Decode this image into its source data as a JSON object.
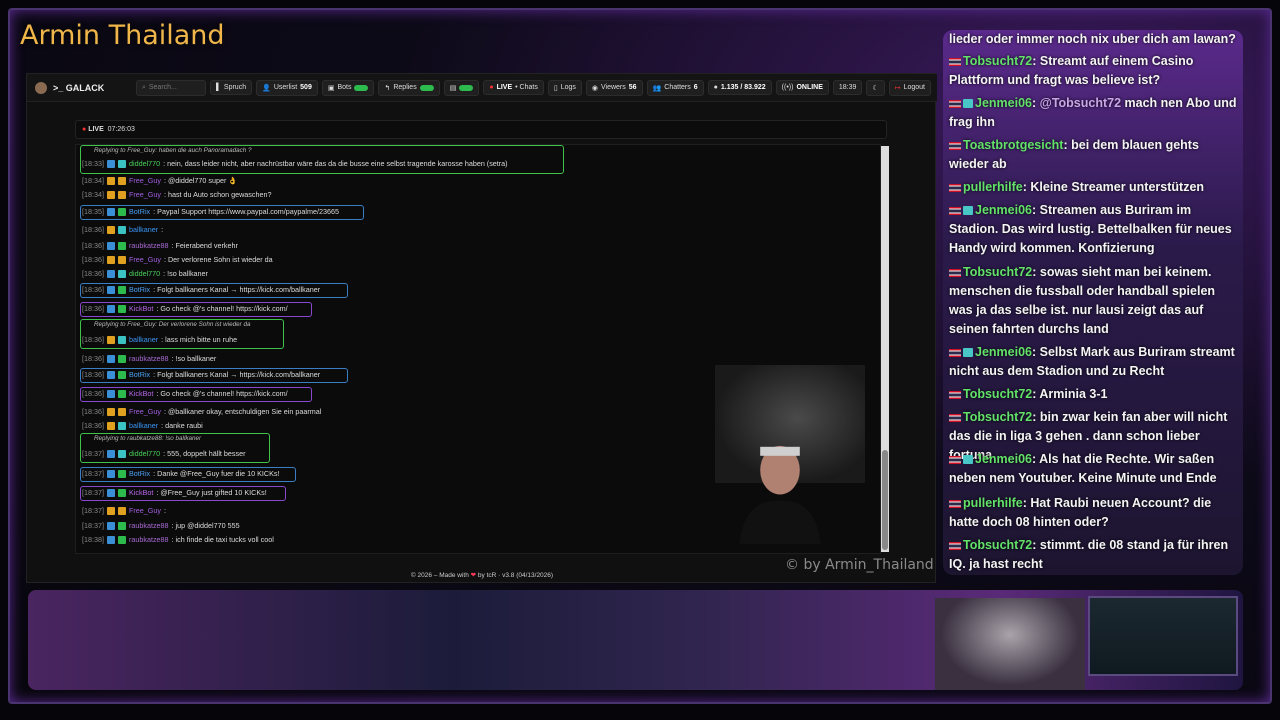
{
  "brand": "Armin Thailand",
  "topbar": {
    "app": ">_ GALACK",
    "search_placeholder": "Search...",
    "spruch": "Spruch",
    "userlist": "Userlist",
    "userlist_count": "509",
    "bots": "Bots",
    "replies": "Replies",
    "live": "LIVE",
    "chats": "• Chats",
    "logs": "Logs",
    "viewers": "Viewers",
    "viewers_count": "56",
    "chatters": "Chatters",
    "chatters_count": "6",
    "stats": "1.135 / 83.922",
    "online": "ONLINE",
    "time": "18:39",
    "logout": "Logout"
  },
  "livebar": {
    "label": "LIVE",
    "duration": "07:26:03"
  },
  "chat": [
    {
      "reply": "Replying to Free_Guy: haben die auch Panoramadach ?"
    },
    {
      "ts": "[18:33]",
      "user": "diddel770",
      "text": ": nein, dass leider nicht, aber nachrüstbar wäre das da die busse eine selbst tragende karosse haben (setra)"
    },
    {
      "ts": "[18:34]",
      "user": "Free_Guy",
      "text": ": @diddel770 super 👌"
    },
    {
      "ts": "[18:34]",
      "user": "Free_Guy",
      "text": ": hast du Auto schon gewaschen?"
    },
    {
      "ts": "[18:35]",
      "user": "BotRix",
      "text": ": Paypal Support https://www.paypal.com/paypalme/23665"
    },
    {
      "ts": "[18:36]",
      "user": "ballkaner",
      "text": ":"
    },
    {
      "ts": "[18:36]",
      "user": "raubkatze88",
      "text": ": Feierabend verkehr"
    },
    {
      "ts": "[18:36]",
      "user": "Free_Guy",
      "text": ": Der verlorene Sohn ist wieder da"
    },
    {
      "ts": "[18:36]",
      "user": "diddel770",
      "text": ": !so ballkaner"
    },
    {
      "ts": "[18:36]",
      "user": "BotRix",
      "text": ": Folgt ballkaners Kanal → https://kick.com/ballkaner"
    },
    {
      "ts": "[18:36]",
      "user": "KickBot",
      "text": ": Go check @'s channel! https://kick.com/"
    },
    {
      "reply": "Replying to Free_Guy: Der verlorene Sohn ist wieder da"
    },
    {
      "ts": "[18:36]",
      "user": "ballkaner",
      "text": ": lass mich bitte un ruhe"
    },
    {
      "ts": "[18:36]",
      "user": "raubkatze88",
      "text": ": !so ballkaner"
    },
    {
      "ts": "[18:36]",
      "user": "BotRix",
      "text": ": Folgt ballkaners Kanal → https://kick.com/ballkaner"
    },
    {
      "ts": "[18:36]",
      "user": "KickBot",
      "text": ": Go check @'s channel! https://kick.com/"
    },
    {
      "ts": "[18:36]",
      "user": "Free_Guy",
      "text": ": @ballkaner okay, entschuldigen Sie ein paarmal"
    },
    {
      "ts": "[18:36]",
      "user": "ballkaner",
      "text": ": danke raubi"
    },
    {
      "reply": "Replying to raubkatze88: !so ballkaner"
    },
    {
      "ts": "[18:37]",
      "user": "diddel770",
      "text": ": 555, doppelt hällt besser"
    },
    {
      "ts": "[18:37]",
      "user": "BotRix",
      "text": ": Danke @Free_Guy fuer die 10 KICKs!"
    },
    {
      "ts": "[18:37]",
      "user": "KickBot",
      "text": ": @Free_Guy just gifted 10 KICKs!"
    },
    {
      "ts": "[18:37]",
      "user": "Free_Guy",
      "text": ":"
    },
    {
      "ts": "[18:37]",
      "user": "raubkatze88",
      "text": ": jup @diddel770 555"
    },
    {
      "ts": "[18:38]",
      "user": "raubkatze88",
      "text": ": ich finde die taxi tucks voll cool"
    }
  ],
  "footer": {
    "pre": "© 2026 – Made with",
    "post": "by tcR · v3.8 (04/13/2026)"
  },
  "watermark": "© by Armin_Thailand",
  "side": [
    {
      "text": "lieder oder immer noch nix uber dich am lawan?"
    },
    {
      "user": "Tobsucht72",
      "text": ": Streamt auf einem Casino Plattform und fragt was believe ist?"
    },
    {
      "user": "Jenmei06",
      "mention": "@Tobsucht72",
      "text": " mach nen Abo und frag ihn"
    },
    {
      "user": "Toastbrotgesicht",
      "text": ": bei dem blauen gehts wieder ab"
    },
    {
      "user": "pullerhilfe",
      "text": ": Kleine Streamer unterstützen"
    },
    {
      "user": "Jenmei06",
      "text": ": Streamen aus Buriram im Stadion. Das wird lustig. Bettelbalken für neues Handy wird kommen. Konfizierung"
    },
    {
      "user": "Tobsucht72",
      "text": ": sowas sieht man bei keinem. menschen die fussball oder handball spielen was ja das selbe ist. nur lausi zeigt das auf seinen fahrten durchs land"
    },
    {
      "user": "Jenmei06",
      "text": ": Selbst Mark aus Buriram streamt nicht aus dem Stadion und zu Recht"
    },
    {
      "user": "Tobsucht72",
      "text": ": Arminia 3-1"
    },
    {
      "user": "Tobsucht72",
      "text": ": bin zwar kein fan aber will nicht das die in liga 3 gehen . dann schon lieber fortuna"
    },
    {
      "user": "Jenmei06",
      "text": ": Als hat die Rechte. Wir saßen neben nem Youtuber. Keine Minute und Ende"
    },
    {
      "user": "pullerhilfe",
      "text": ": Hat Raubi neuen Account? die hatte doch 08 hinten oder?"
    },
    {
      "user": "Tobsucht72",
      "text": ": stimmt. die 08 stand ja für ihren IQ. ja hast recht"
    }
  ]
}
